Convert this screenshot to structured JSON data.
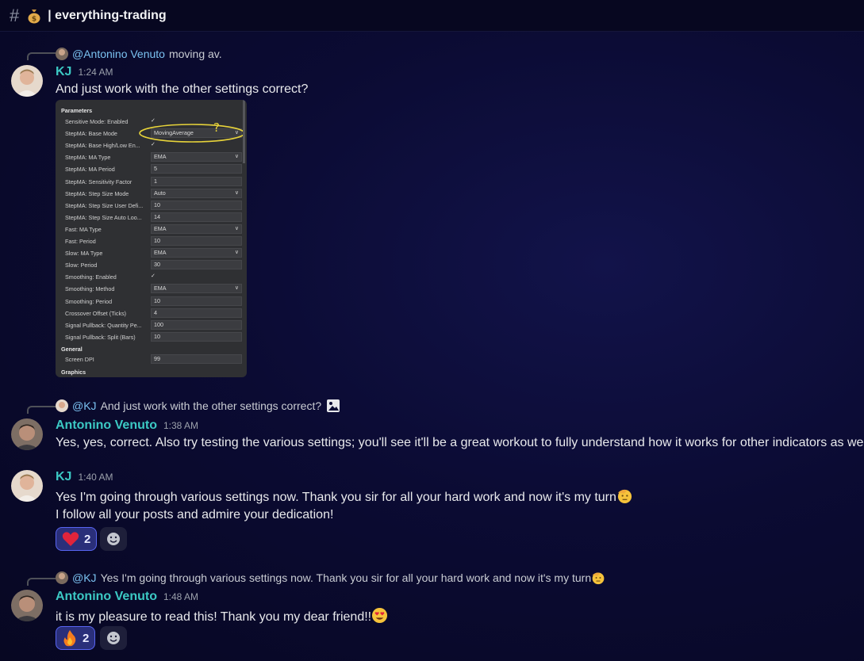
{
  "channel": {
    "name": "everything-trading",
    "icon": "money-bag-icon"
  },
  "messages": [
    {
      "reply": {
        "mention": "@Antonino Venuto",
        "text": "moving av."
      },
      "author": "KJ",
      "time": "1:24 AM",
      "text": "And just work with the other settings  correct?",
      "attachment": {
        "sections": [
          "Parameters",
          "General",
          "Graphics"
        ],
        "rows": [
          {
            "label": "Sensitive Mode: Enabled",
            "value": "",
            "kind": "check"
          },
          {
            "label": "StepMA: Base Mode",
            "value": "MovingAverage",
            "kind": "select"
          },
          {
            "label": "StepMA: Base High/Low En...",
            "value": "",
            "kind": "check"
          },
          {
            "label": "StepMA: MA Type",
            "value": "EMA",
            "kind": "select"
          },
          {
            "label": "StepMA: MA Period",
            "value": "5",
            "kind": "text"
          },
          {
            "label": "StepMA: Sensitivity Factor",
            "value": "1",
            "kind": "text"
          },
          {
            "label": "StepMA: Step Size Mode",
            "value": "Auto",
            "kind": "select"
          },
          {
            "label": "StepMA: Step Size User Defi...",
            "value": "10",
            "kind": "text"
          },
          {
            "label": "StepMA: Step Size Auto Loo...",
            "value": "14",
            "kind": "text"
          },
          {
            "label": "Fast: MA Type",
            "value": "EMA",
            "kind": "select"
          },
          {
            "label": "Fast: Period",
            "value": "10",
            "kind": "text"
          },
          {
            "label": "Slow: MA Type",
            "value": "EMA",
            "kind": "select"
          },
          {
            "label": "Slow: Period",
            "value": "30",
            "kind": "text"
          },
          {
            "label": "Smoothing: Enabled",
            "value": "",
            "kind": "check"
          },
          {
            "label": "Smoothing: Method",
            "value": "EMA",
            "kind": "select"
          },
          {
            "label": "Smoothing: Period",
            "value": "10",
            "kind": "text"
          },
          {
            "label": "Crossover Offset (Ticks)",
            "value": "4",
            "kind": "text"
          },
          {
            "label": "Signal Pullback: Quantity Pe...",
            "value": "100",
            "kind": "text"
          },
          {
            "label": "Signal Pullback: Split (Bars)",
            "value": "10",
            "kind": "text"
          }
        ],
        "general_row": {
          "label": "Screen DPI",
          "value": "99"
        },
        "annotation": "?"
      }
    },
    {
      "reply": {
        "mention": "@KJ",
        "text": "And just work with the other settings  correct?"
      },
      "author": "Antonino Venuto",
      "time": "1:38 AM",
      "text": "Yes, yes, correct. Also try testing the various settings; you'll see it'll be a great workout to fully understand how it works for other indicators as well."
    },
    {
      "author": "KJ",
      "time": "1:40 AM",
      "text": "Yes I'm going through various settings now. Thank you sir for all your hard work and now it's my turn",
      "text2": "I follow all your posts and admire your dedication!",
      "reaction": {
        "emoji": "heart",
        "count": "2"
      }
    },
    {
      "reply": {
        "mention": "@KJ",
        "text": "Yes I'm going through various settings now. Thank you sir for all your hard work and now it's my turn"
      },
      "author": "Antonino Venuto",
      "time": "1:48 AM",
      "text": "it is my pleasure to  read this! Thank you my dear friend!!",
      "reaction": {
        "emoji": "fire",
        "count": "2"
      }
    }
  ],
  "colors": {
    "username": "#3cc9c4",
    "mention": "#7bc2f1",
    "reaction_active": "#5865f2"
  }
}
